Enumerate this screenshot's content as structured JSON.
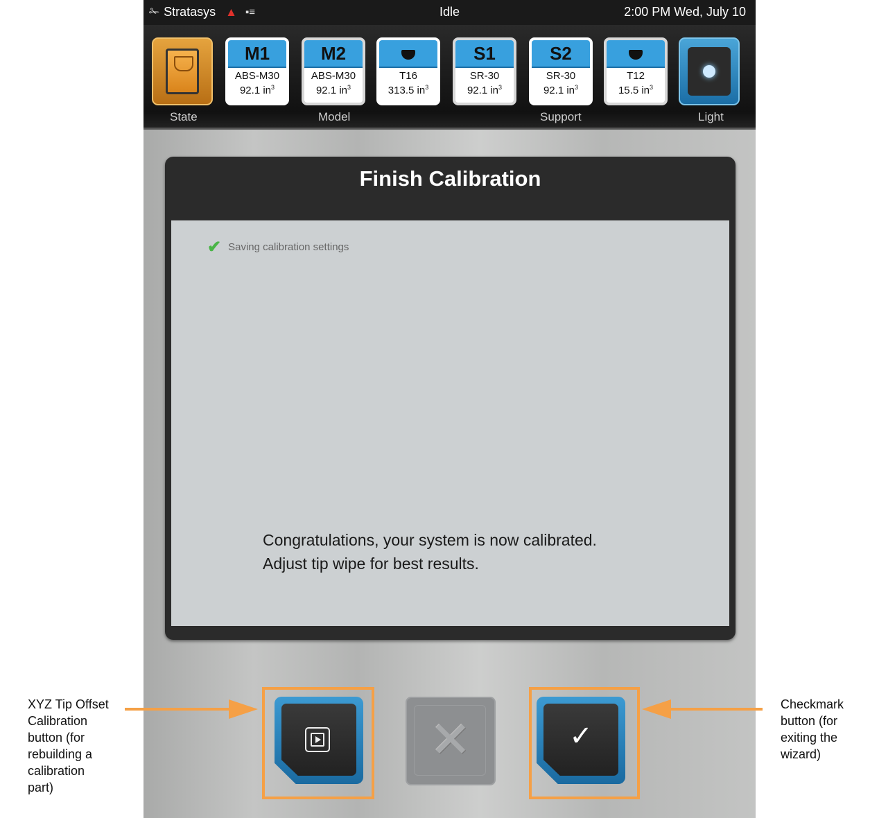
{
  "statusbar": {
    "brand": "Stratasys",
    "state": "Idle",
    "datetime": "2:00 PM Wed, July 10"
  },
  "toolbar": {
    "state_label": "State",
    "light_label": "Light",
    "model_label": "Model",
    "support_label": "Support",
    "materials": [
      {
        "header": "M1",
        "name": "ABS-M30",
        "volume": "92.1 in",
        "unit_exp": "3"
      },
      {
        "header": "M2",
        "name": "ABS-M30",
        "volume": "92.1 in",
        "unit_exp": "3"
      },
      {
        "header": "tip-icon",
        "name": "T16",
        "volume": "313.5 in",
        "unit_exp": "3"
      },
      {
        "header": "S1",
        "name": "SR-30",
        "volume": "92.1 in",
        "unit_exp": "3"
      },
      {
        "header": "S2",
        "name": "SR-30",
        "volume": "92.1 in",
        "unit_exp": "3"
      },
      {
        "header": "tip-icon",
        "name": "T12",
        "volume": "15.5 in",
        "unit_exp": "3"
      }
    ]
  },
  "dialog": {
    "title": "Finish Calibration",
    "status_text": "Saving calibration settings",
    "message_line1": "Congratulations, your system is now calibrated.",
    "message_line2": "Adjust tip wipe for best results."
  },
  "callouts": {
    "left": "XYZ Tip Offset\nCalibration\nbutton (for\nrebuilding a\ncalibration\npart)",
    "right": "Checkmark\nbutton (for\nexiting the\nwizard)"
  },
  "colors": {
    "accent_blue": "#38a0de",
    "state_orange": "#e5a33e",
    "callout_orange": "#f5a046",
    "success_green": "#4ab547"
  }
}
